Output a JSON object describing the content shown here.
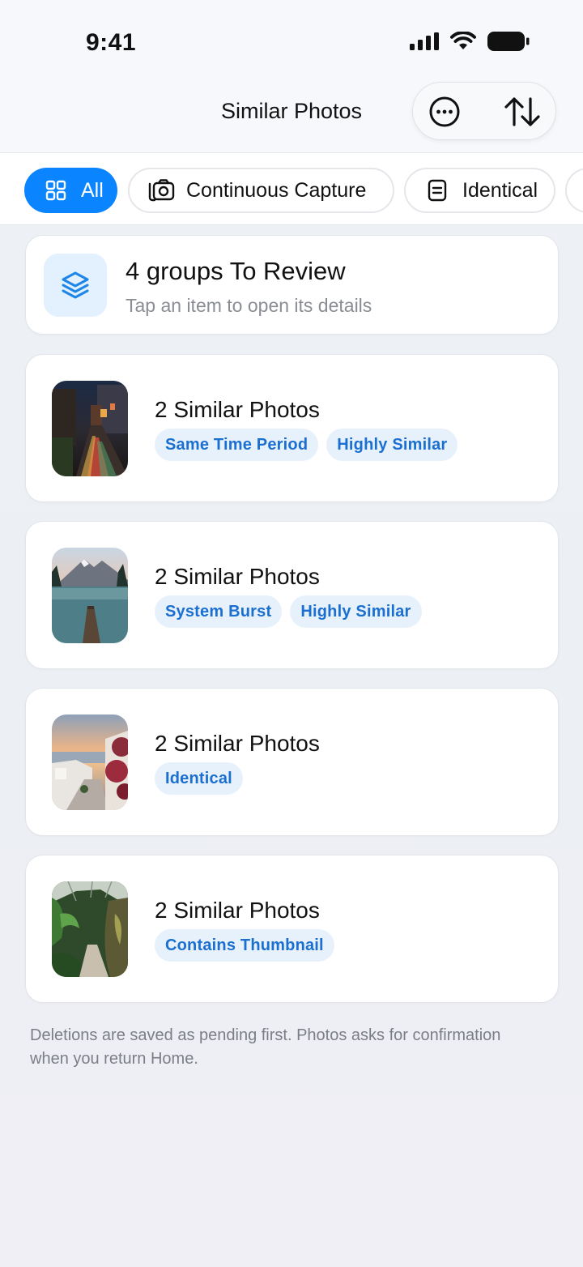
{
  "status_bar": {
    "time": "9:41"
  },
  "nav": {
    "title": "Similar Photos",
    "more_icon": "ellipsis-circle-icon",
    "sort_icon": "sort-arrows-icon"
  },
  "filters": [
    {
      "label": "All",
      "icon": "grid-icon",
      "active": true
    },
    {
      "label": "Continuous Capture",
      "icon": "burst-camera-icon",
      "active": false
    },
    {
      "label": "Identical",
      "icon": "document-icon",
      "active": false
    }
  ],
  "summary": {
    "icon": "layers-icon",
    "title": "4 groups To Review",
    "subtitle": "Tap an item to open its details"
  },
  "groups": [
    {
      "title": "2 Similar Photos",
      "thumbnail": "rainy-street-night",
      "tags": [
        "Same Time Period",
        "Highly Similar"
      ]
    },
    {
      "title": "2 Similar Photos",
      "thumbnail": "mountain-lake-dock",
      "tags": [
        "System Burst",
        "Highly Similar"
      ]
    },
    {
      "title": "2 Similar Photos",
      "thumbnail": "seaside-village-sunset",
      "tags": [
        "Identical"
      ]
    },
    {
      "title": "2 Similar Photos",
      "thumbnail": "greenhouse-garden-path",
      "tags": [
        "Contains Thumbnail"
      ]
    }
  ],
  "footer_note": "Deletions are saved as pending first. Photos asks for confirmation when you return Home.",
  "colors": {
    "accent": "#0a84ff",
    "tag_bg": "#e7f1fc",
    "tag_text": "#1a6fd0"
  }
}
